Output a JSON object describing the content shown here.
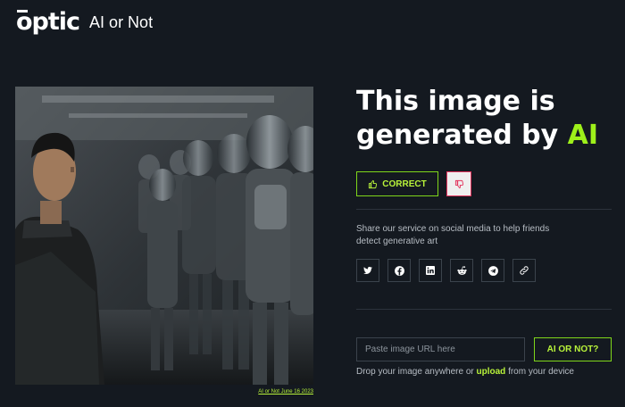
{
  "header": {
    "logo_text": "optic",
    "app_name": "AI or Not"
  },
  "image": {
    "alt": "Man standing beside rows of humanoid robots",
    "credit": "AI or Not June 16 2023"
  },
  "result": {
    "headline_prefix": "This image is generated by ",
    "headline_accent": "AI"
  },
  "feedback": {
    "correct_label": "CORRECT",
    "correct_icon": "thumbs-up-icon",
    "wrong_icon": "thumbs-down-icon"
  },
  "share": {
    "text": "Share our service on social media to help friends detect generative art",
    "networks": [
      "twitter-icon",
      "facebook-icon",
      "linkedin-icon",
      "reddit-icon",
      "telegram-icon",
      "link-icon"
    ]
  },
  "check": {
    "url_placeholder": "Paste image URL here",
    "url_value": "",
    "button_label": "AI OR NOT?",
    "drop_prefix": "Drop your image anywhere or ",
    "drop_link": "upload",
    "drop_suffix": " from your device"
  },
  "colors": {
    "background": "#141920",
    "accent": "#9ef01a",
    "accent_border": "#7fd61a",
    "danger": "#e2335c"
  }
}
